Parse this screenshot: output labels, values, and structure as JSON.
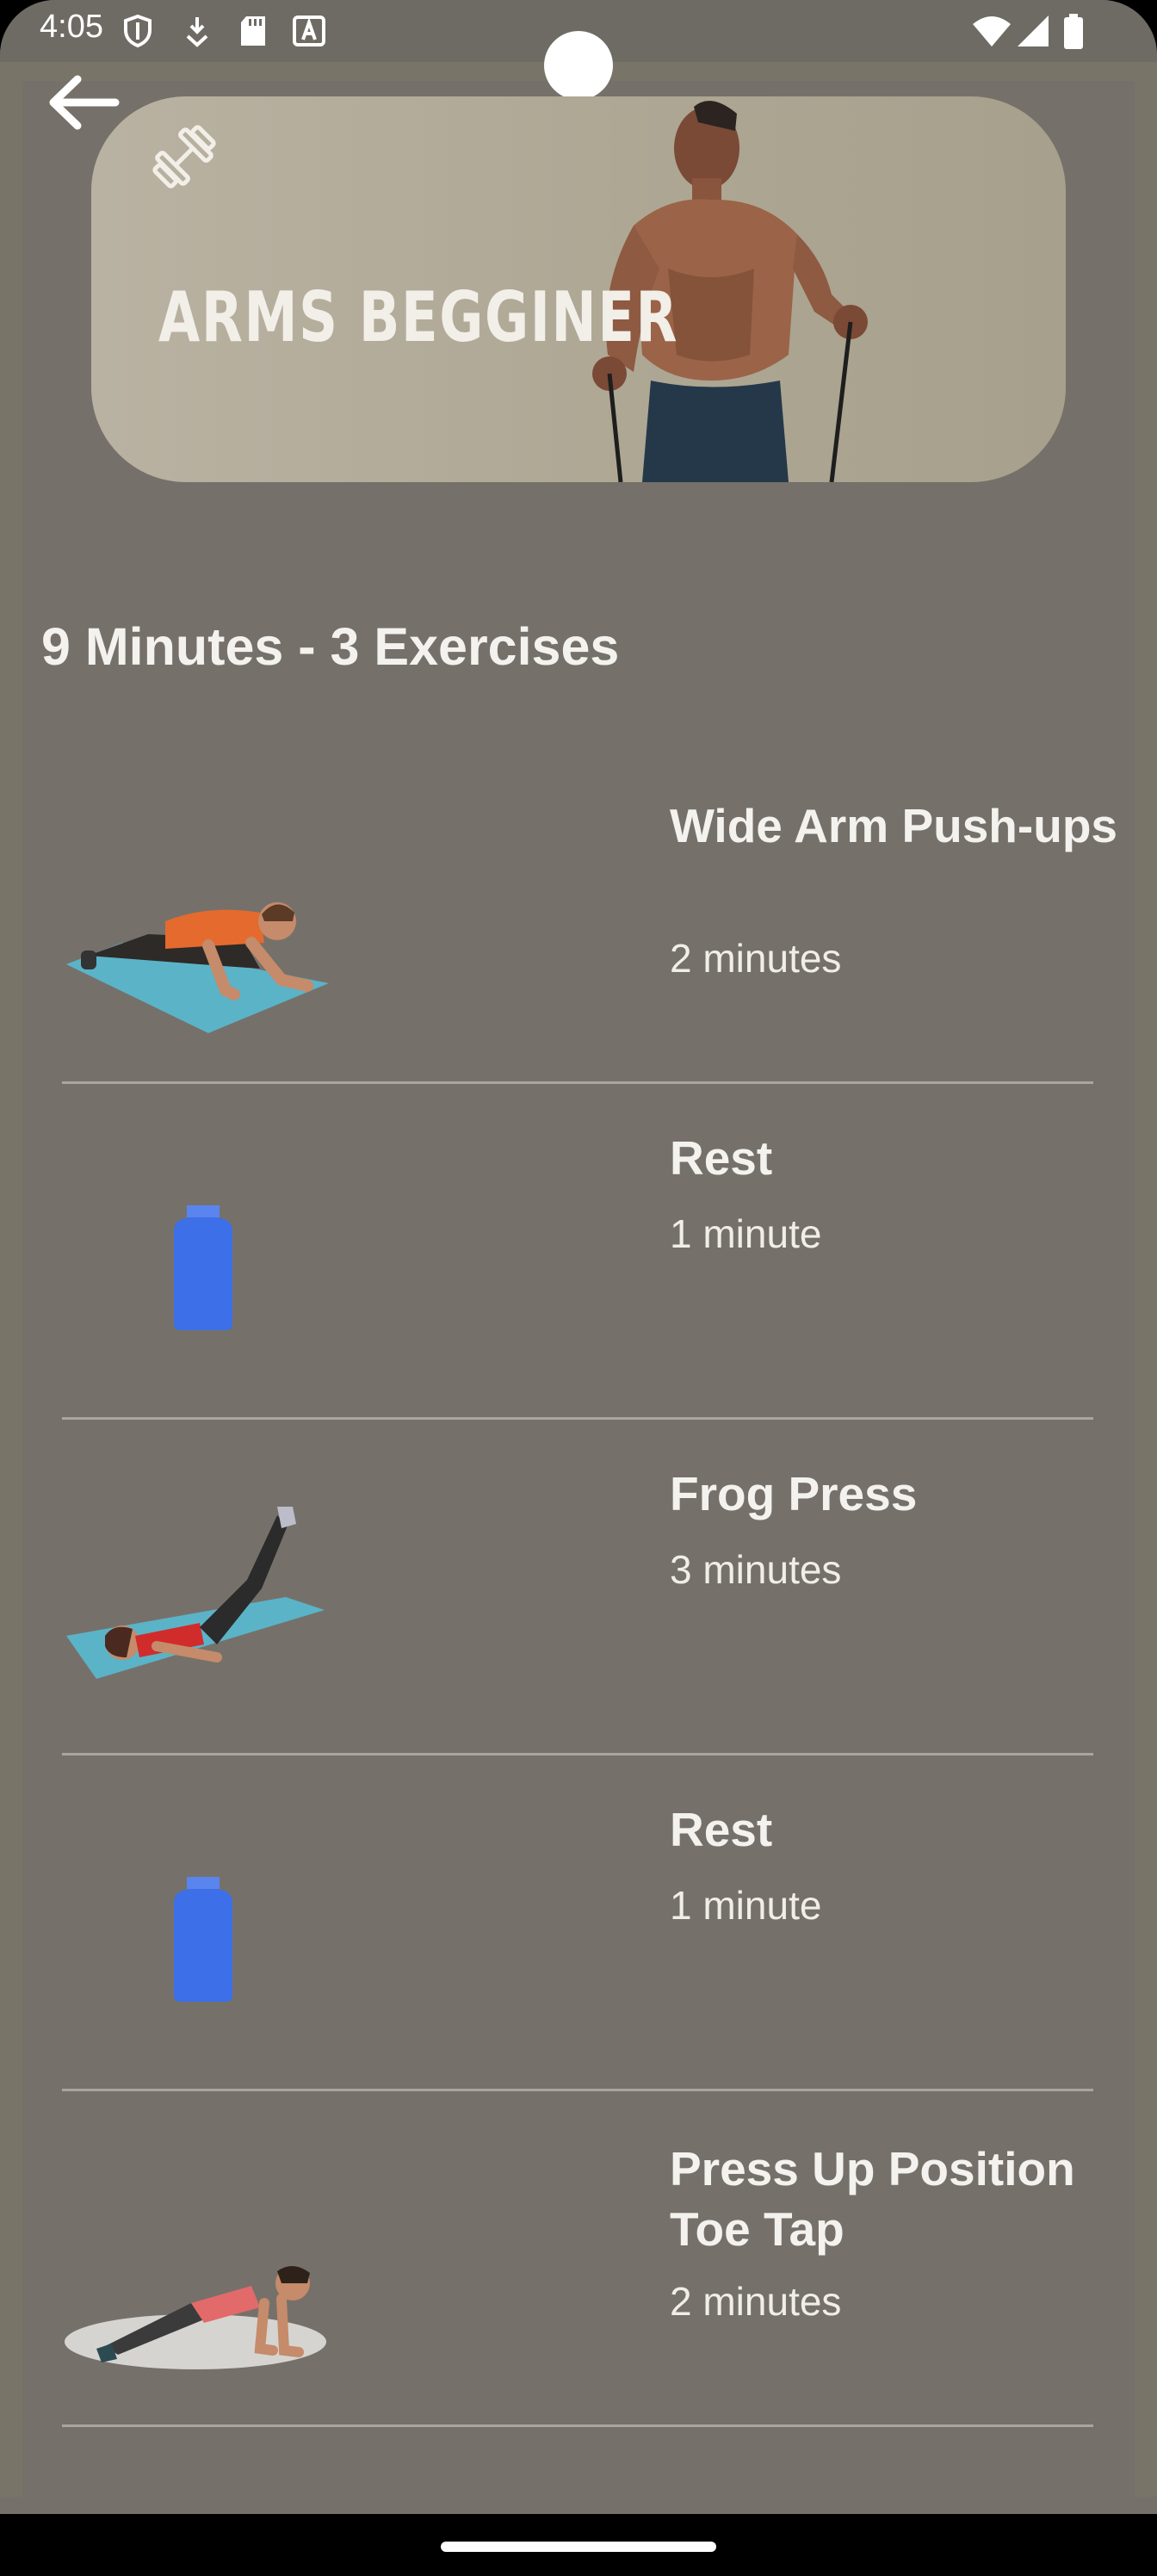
{
  "status_bar": {
    "time": "4:05",
    "icons": [
      "shield-icon",
      "download-icon",
      "sd-card-icon",
      "font-icon",
      "wifi-icon",
      "signal-icon",
      "battery-icon"
    ]
  },
  "header": {
    "back_icon": "arrow-left-icon",
    "banner_title": "ARMS BEGGINER",
    "banner_icon": "dumbbell-icon"
  },
  "summary": "9 Minutes - 3 Exercises",
  "exercises": [
    {
      "title": "Wide Arm Push-ups",
      "duration": "2 minutes",
      "icon": "push-up-figure"
    },
    {
      "title": "Rest",
      "duration": "1 minute",
      "icon": "water-bottle-icon"
    },
    {
      "title": "Frog Press",
      "duration": "3 minutes",
      "icon": "frog-press-figure"
    },
    {
      "title": "Rest",
      "duration": "1 minute",
      "icon": "water-bottle-icon"
    },
    {
      "title": "Press Up Position Toe Tap",
      "duration": "2 minutes",
      "icon": "toe-tap-figure"
    }
  ],
  "colors": {
    "background": "#75716a",
    "banner": "#b0a996",
    "text": "#f4f2ee",
    "bottle": "#3d6fe8"
  }
}
